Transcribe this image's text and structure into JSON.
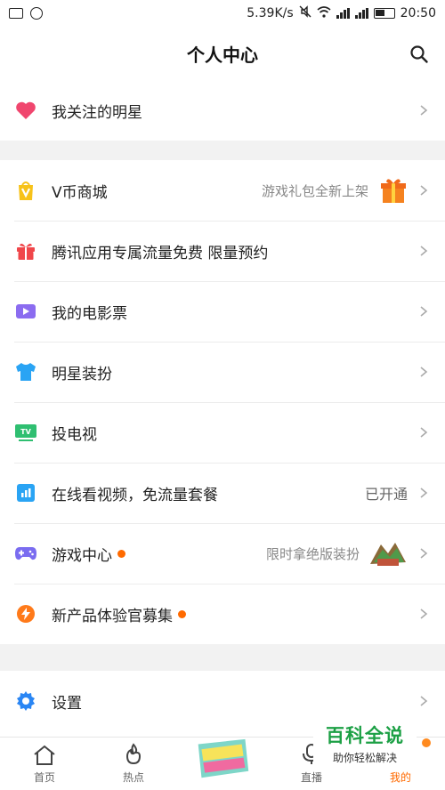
{
  "status_bar": {
    "speed": "5.39K/s",
    "time": "20:50"
  },
  "header": {
    "title": "个人中心",
    "search_icon": "search-icon"
  },
  "groups": {
    "first": [
      {
        "label": "我关注的明星",
        "icon": "heart-icon",
        "color": "#f0466e"
      }
    ],
    "second": [
      {
        "label": "V币商城",
        "icon": "v-coin-bag-icon",
        "color": "#f7c21a",
        "value": "游戏礼包全新上架"
      },
      {
        "label": "腾讯应用专属流量免费 限量预约",
        "icon": "gift-box-icon",
        "color": "#f0464a"
      },
      {
        "label": "我的电影票",
        "icon": "movie-ticket-icon",
        "color": "#8b6cf0"
      },
      {
        "label": "明星装扮",
        "icon": "tshirt-icon",
        "color": "#2aa4f4"
      },
      {
        "label": "投电视",
        "icon": "tv-icon",
        "color": "#2fbf71"
      },
      {
        "label": "在线看视频，免流量套餐",
        "icon": "data-chart-icon",
        "color": "#2aa4f4",
        "value": "已开通"
      },
      {
        "label": "游戏中心",
        "icon": "gamepad-icon",
        "color": "#7a6cf0",
        "value": "限时拿绝版装扮"
      },
      {
        "label": "新产品体验官募集",
        "icon": "lightning-badge-icon",
        "color": "#ff7a1a"
      }
    ],
    "third": [
      {
        "label": "设置",
        "icon": "gear-icon",
        "color": "#2a86f4"
      }
    ]
  },
  "tabs": [
    {
      "label": "首页",
      "icon": "home-icon"
    },
    {
      "label": "热点",
      "icon": "flame-icon"
    },
    {
      "label": "",
      "icon": "center-promo-badge-icon"
    },
    {
      "label": "直播",
      "icon": "live-icon"
    },
    {
      "label": "我的",
      "icon": "profile-icon",
      "active": true
    }
  ],
  "watermark": {
    "title": "百科全说",
    "subtitle": "助你轻松解决"
  },
  "colors": {
    "accent": "#ff6a00",
    "background": "#f2f2f2"
  }
}
